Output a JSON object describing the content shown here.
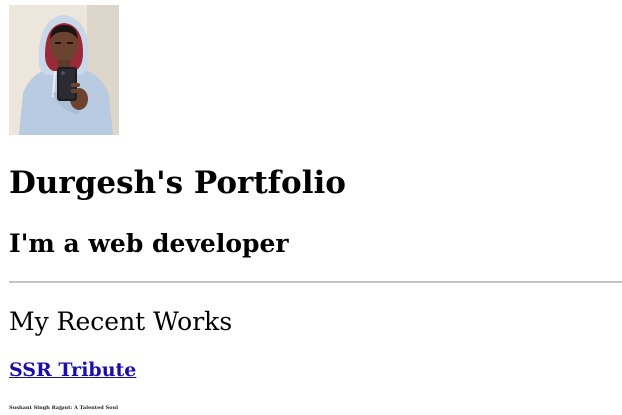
{
  "profile": {
    "avatar_alt": "Durgesh profile photo",
    "name_heading": "Durgesh's Portfolio",
    "tagline": "I'm a web developer"
  },
  "works": {
    "heading": "My Recent Works",
    "items": [
      {
        "link_label": "SSR Tribute",
        "caption": "Sushant Singh Rajput: A Talented Soul"
      }
    ]
  },
  "colors": {
    "link": "#1a0dab",
    "divider": "#c4c4c4",
    "background": "#ffffff"
  }
}
